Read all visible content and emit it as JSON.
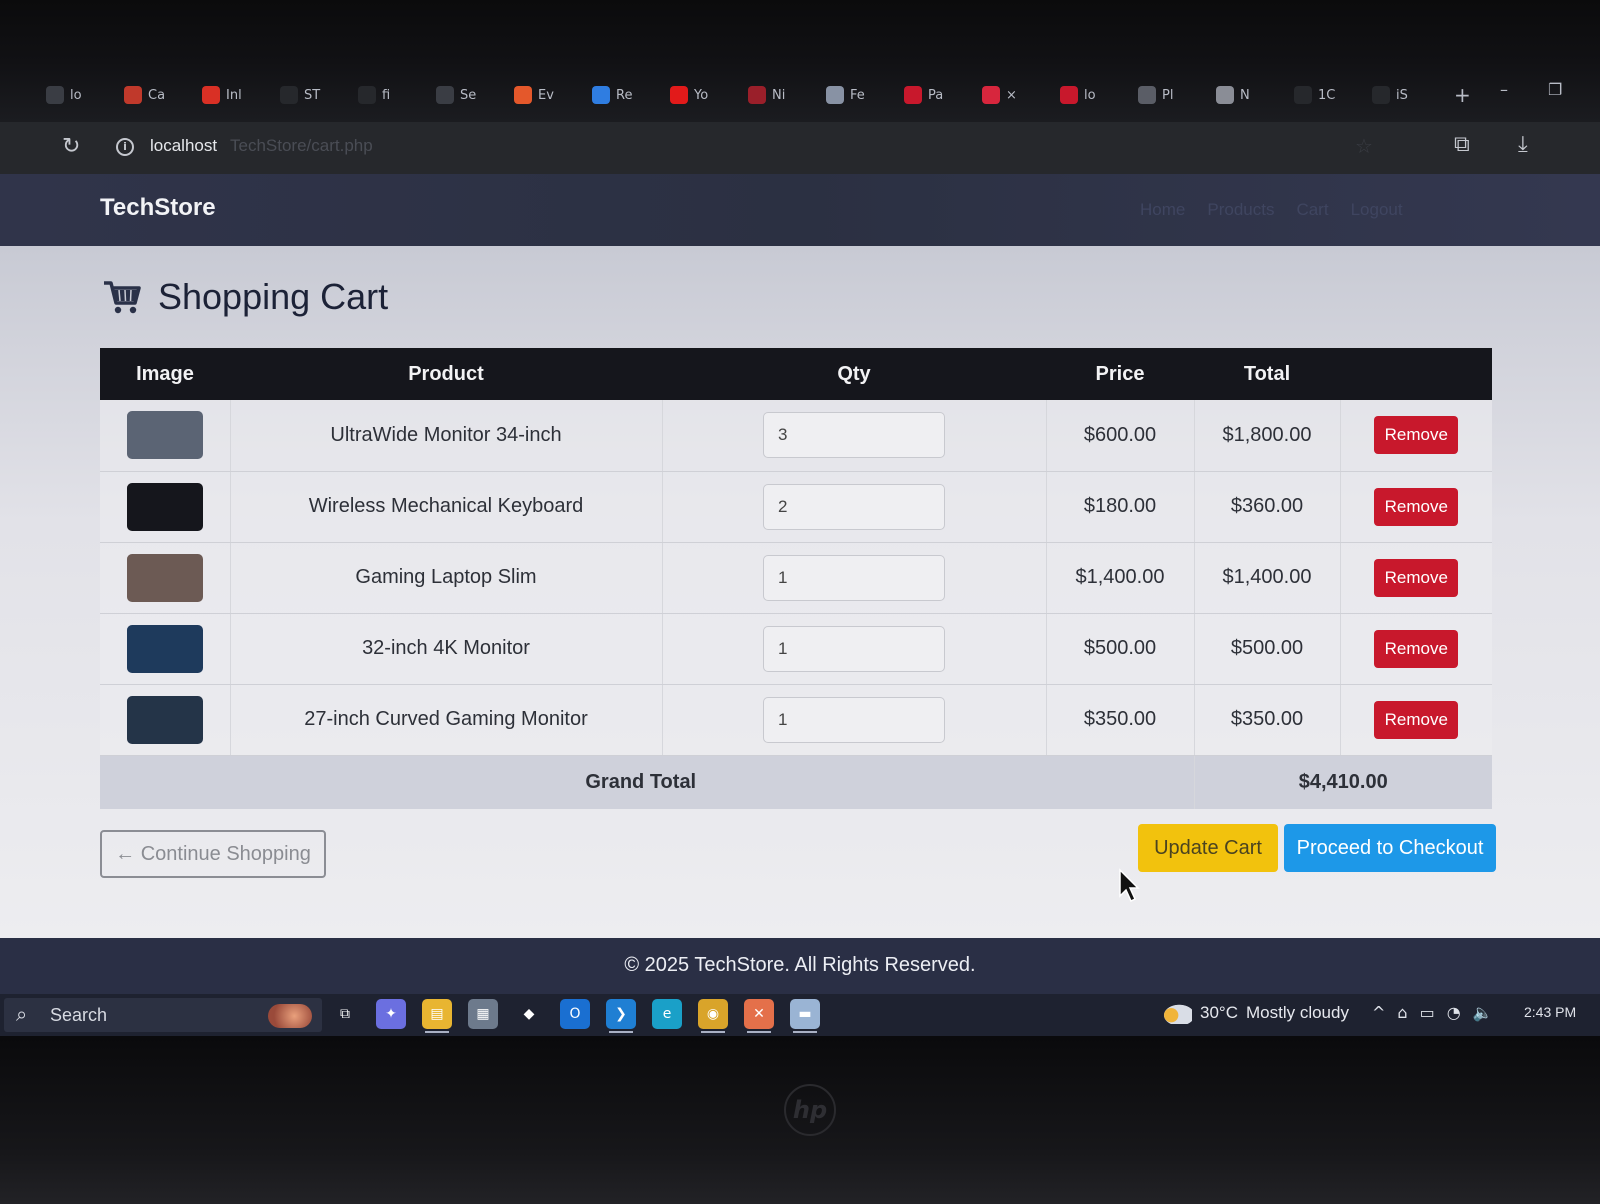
{
  "browser": {
    "tabs": [
      {
        "label": "lo",
        "color": "#3a3d44"
      },
      {
        "label": "Ca",
        "color": "#c0392b"
      },
      {
        "label": "Inl",
        "color": "#d93025"
      },
      {
        "label": "ST",
        "color": "#26282c"
      },
      {
        "label": "fi",
        "color": "#26282c"
      },
      {
        "label": "Se",
        "color": "#3a3d44"
      },
      {
        "label": "Ev",
        "color": "#e4582b"
      },
      {
        "label": "Re",
        "color": "#2f7de1"
      },
      {
        "label": "Yo",
        "color": "#e21a1a"
      },
      {
        "label": "Ni",
        "color": "#9a1f2a"
      },
      {
        "label": "Fe",
        "color": "#8892a4"
      },
      {
        "label": "Pa",
        "color": "#c8182c"
      },
      {
        "label": "×",
        "color": "#d7263d"
      },
      {
        "label": "lo",
        "color": "#c8182c"
      },
      {
        "label": "Pl",
        "color": "#5a5d66"
      },
      {
        "label": "N",
        "color": "#8a8d96"
      },
      {
        "label": "1C",
        "color": "#26282c"
      },
      {
        "label": "iS",
        "color": "#26282c"
      }
    ],
    "new_tab": "+",
    "minimize": "–",
    "restore": "❐",
    "url_host": "localhost",
    "url_path": "TechStore/cart.php"
  },
  "site": {
    "brand": "TechStore",
    "nav": [
      "Home",
      "Products",
      "Cart",
      "Logout"
    ]
  },
  "page": {
    "title": "Shopping Cart",
    "icon": "shopping-cart-icon"
  },
  "table": {
    "headers": {
      "image": "Image",
      "product": "Product",
      "qty": "Qty",
      "price": "Price",
      "total": "Total"
    },
    "rows": [
      {
        "product": "UltraWide Monitor 34-inch",
        "qty": "3",
        "price": "$600.00",
        "total": "$1,800.00",
        "remove": "Remove",
        "thumb_color": "#5b6474"
      },
      {
        "product": "Wireless Mechanical Keyboard",
        "qty": "2",
        "price": "$180.00",
        "total": "$360.00",
        "remove": "Remove",
        "thumb_color": "#15161c"
      },
      {
        "product": "Gaming Laptop Slim",
        "qty": "1",
        "price": "$1,400.00",
        "total": "$1,400.00",
        "remove": "Remove",
        "thumb_color": "#6c5a54"
      },
      {
        "product": "32-inch 4K Monitor",
        "qty": "1",
        "price": "$500.00",
        "total": "$500.00",
        "remove": "Remove",
        "thumb_color": "#1e3a5c"
      },
      {
        "product": "27-inch Curved Gaming Monitor",
        "qty": "1",
        "price": "$350.00",
        "total": "$350.00",
        "remove": "Remove",
        "thumb_color": "#243448"
      }
    ],
    "grand_total_label": "Grand Total",
    "grand_total_value": "$4,410.00"
  },
  "actions": {
    "continue": "← Continue Shopping",
    "update": "Update Cart",
    "checkout": "Proceed to Checkout"
  },
  "footer": {
    "text": "© 2025 TechStore. All Rights Reserved."
  },
  "taskbar": {
    "search_placeholder": "Search",
    "apps": [
      {
        "name": "task-view-icon",
        "glyph": "⧉",
        "color": "transparent"
      },
      {
        "name": "copilot-icon",
        "glyph": "✦",
        "color": "#6b6fe0"
      },
      {
        "name": "file-explorer-icon",
        "glyph": "▤",
        "color": "#e8b531"
      },
      {
        "name": "store-icon",
        "glyph": "▦",
        "color": "#6d7a8c"
      },
      {
        "name": "app-icon",
        "glyph": "◆",
        "color": "#1e2230"
      },
      {
        "name": "outlook-icon",
        "glyph": "O",
        "color": "#1a6fd1"
      },
      {
        "name": "vscode-icon",
        "glyph": "❯",
        "color": "#1f7fd3"
      },
      {
        "name": "edge-icon",
        "glyph": "e",
        "color": "#1aa0c8"
      },
      {
        "name": "chrome-icon",
        "glyph": "◉",
        "color": "#d9a42a"
      },
      {
        "name": "xampp-icon",
        "glyph": "✕",
        "color": "#e4704a"
      },
      {
        "name": "terminal-icon",
        "glyph": "▬",
        "color": "#9ab4d4"
      }
    ],
    "weather": {
      "temp": "30°C",
      "condition": "Mostly cloudy"
    },
    "tray": [
      "^",
      "⌂",
      "▭",
      "◔",
      "🔈"
    ],
    "time": "2:43 PM"
  }
}
